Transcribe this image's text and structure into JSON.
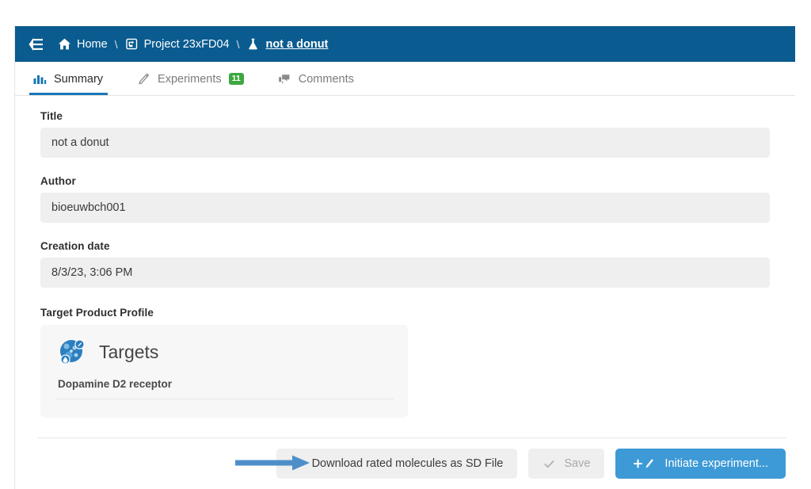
{
  "topbar": {
    "collapse_icon": "collapse-sidebar-icon",
    "breadcrumb": {
      "home_icon": "home-icon",
      "home_label": "Home",
      "separator": "\\",
      "project_icon": "project-icon",
      "project_label": "Project 23xFD04",
      "flask_icon": "flask-icon",
      "current_label": "not a donut"
    }
  },
  "tabs": [
    {
      "label": "Summary",
      "icon": "bar-chart-icon",
      "active": true,
      "badge": null
    },
    {
      "label": "Experiments",
      "icon": "pen-icon",
      "active": false,
      "badge": "11"
    },
    {
      "label": "Comments",
      "icon": "comments-icon",
      "active": false,
      "badge": null
    }
  ],
  "form": {
    "title": {
      "label": "Title",
      "value": "not a donut"
    },
    "author": {
      "label": "Author",
      "value": "bioeuwbch001"
    },
    "creation_date": {
      "label": "Creation date",
      "value": "8/3/23, 3:06 PM"
    },
    "target_product_profile": {
      "label": "Target Product Profile",
      "card_icon": "target-protein-icon",
      "card_title": "Targets",
      "items": [
        "Dopamine D2 receptor"
      ]
    }
  },
  "footer": {
    "download_button": {
      "label": "Download rated molecules as SD File",
      "icon": "cloud-download-icon"
    },
    "save_button": {
      "label": "Save",
      "icon": "check-icon",
      "disabled": true
    },
    "initiate_button": {
      "label": "Initiate experiment...",
      "icon": "plus-pen-icon"
    }
  },
  "annotation": {
    "type": "arrow",
    "color": "#4f8fc9",
    "points_to": "download-rated-molecules-button"
  },
  "colors": {
    "topbar": "#0a5b8f",
    "accent": "#1a77b4",
    "primary_button": "#3d9ad6",
    "badge_green": "#3da83f",
    "field_background": "#efefef",
    "card_background": "#f7f7f7"
  }
}
